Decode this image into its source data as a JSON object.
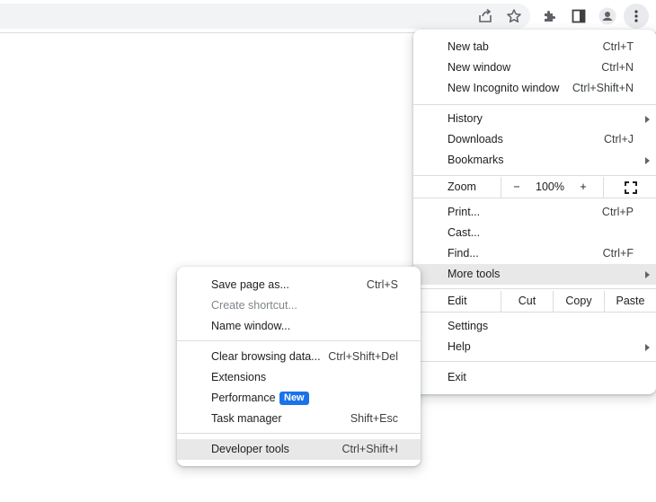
{
  "toolbar": {
    "icons": [
      "share-icon",
      "bookmark-star-icon",
      "extensions-puzzle-icon",
      "side-panel-icon",
      "profile-avatar-icon",
      "more-menu-kebab-icon"
    ]
  },
  "main_menu": {
    "new_tab": {
      "label": "New tab",
      "shortcut": "Ctrl+T"
    },
    "new_window": {
      "label": "New window",
      "shortcut": "Ctrl+N"
    },
    "new_incognito": {
      "label": "New Incognito window",
      "shortcut": "Ctrl+Shift+N"
    },
    "history": {
      "label": "History"
    },
    "downloads": {
      "label": "Downloads",
      "shortcut": "Ctrl+J"
    },
    "bookmarks": {
      "label": "Bookmarks"
    },
    "zoom": {
      "label": "Zoom",
      "minus": "−",
      "level": "100%",
      "plus": "+"
    },
    "print": {
      "label": "Print...",
      "shortcut": "Ctrl+P"
    },
    "cast": {
      "label": "Cast..."
    },
    "find": {
      "label": "Find...",
      "shortcut": "Ctrl+F"
    },
    "more_tools": {
      "label": "More tools"
    },
    "edit": {
      "label": "Edit",
      "cut": "Cut",
      "copy": "Copy",
      "paste": "Paste"
    },
    "settings": {
      "label": "Settings"
    },
    "help": {
      "label": "Help"
    },
    "exit": {
      "label": "Exit"
    }
  },
  "more_tools_menu": {
    "save_page": {
      "label": "Save page as...",
      "shortcut": "Ctrl+S"
    },
    "create_shortcut": {
      "label": "Create shortcut..."
    },
    "name_window": {
      "label": "Name window..."
    },
    "clear_browsing": {
      "label": "Clear browsing data...",
      "shortcut": "Ctrl+Shift+Del"
    },
    "extensions": {
      "label": "Extensions"
    },
    "performance": {
      "label": "Performance",
      "badge": "New"
    },
    "task_manager": {
      "label": "Task manager",
      "shortcut": "Shift+Esc"
    },
    "developer_tools": {
      "label": "Developer tools",
      "shortcut": "Ctrl+Shift+I"
    }
  },
  "colors": {
    "highlight": "#e8e8e8",
    "badge": "#1a73e8",
    "separator": "#dadce0"
  }
}
